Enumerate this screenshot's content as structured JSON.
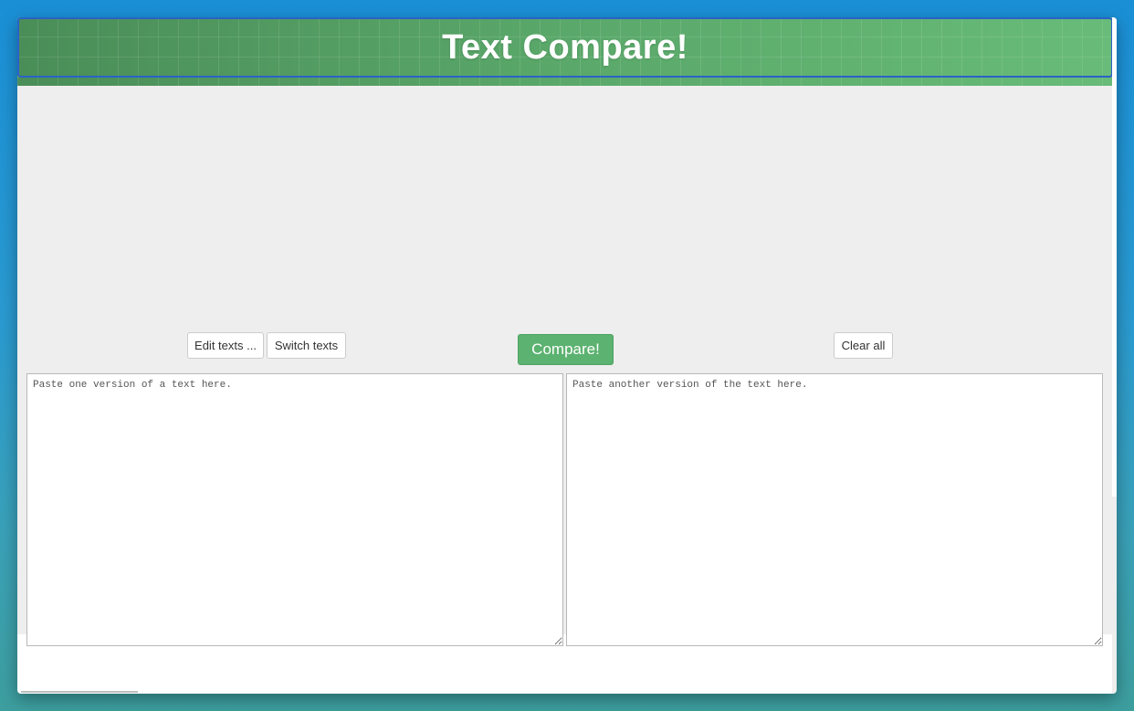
{
  "app": {
    "title": "Text Compare!"
  },
  "toolbar": {
    "edit_label": "Edit texts ...",
    "switch_label": "Switch texts",
    "compare_label": "Compare!",
    "clear_label": "Clear all"
  },
  "editors": {
    "left_placeholder": "Paste one version of a text here.",
    "right_placeholder": "Paste another version of the text here."
  },
  "colors": {
    "header_green": "#5aa86a",
    "compare_button": "#5cb270",
    "header_border": "#2a62c8"
  }
}
